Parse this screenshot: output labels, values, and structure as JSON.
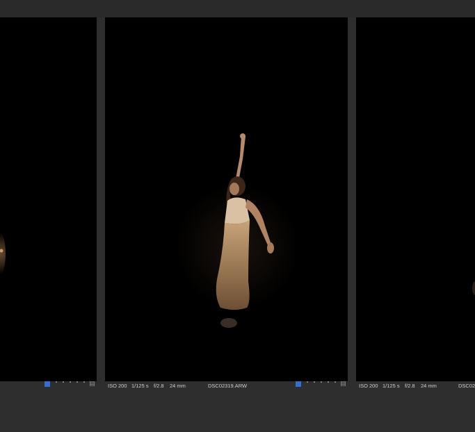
{
  "cells": [
    {
      "iso": "",
      "shutter": "",
      "aperture": "",
      "focal": "",
      "filename": "",
      "color_label": "#2f6fd6",
      "rating": 0
    },
    {
      "iso": "ISO 200",
      "shutter": "1/125 s",
      "aperture": "f/2.8",
      "focal": "24 mm",
      "filename": "DSC02319.ARW",
      "color_label": "#2f6fd6",
      "rating": 0
    },
    {
      "iso": "ISO 200",
      "shutter": "1/125 s",
      "aperture": "f/2.8",
      "focal": "24 mm",
      "filename": "DSC02",
      "color_label": "#2f6fd6",
      "rating": 0
    }
  ],
  "icons": {
    "rating_dots": "rating-dots-icon",
    "grid": "grid-icon"
  },
  "colors": {
    "background": "#2e2e2e",
    "photo_bg": "#000000",
    "label_blue": "#2f6fd6",
    "meta_text": "#cfcfcf"
  }
}
